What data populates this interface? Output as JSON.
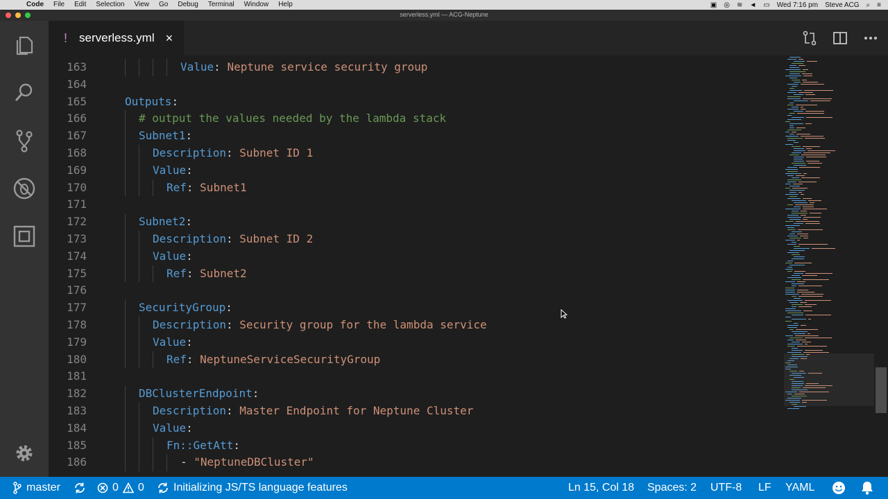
{
  "menubar": {
    "apple_icon": "apple-logo-icon",
    "items": [
      "Code",
      "File",
      "Edit",
      "Selection",
      "View",
      "Go",
      "Debug",
      "Terminal",
      "Window",
      "Help"
    ],
    "clock": "Wed 7:16 pm",
    "user": "Steve ACG"
  },
  "window": {
    "title": "serverless.yml — ACG-Neptune"
  },
  "activity_bar": [
    "files-icon",
    "search-icon",
    "source-control-icon",
    "debug-icon",
    "extensions-icon",
    "gear-icon"
  ],
  "tab": {
    "modified_marker": "!",
    "filename": "serverless.yml",
    "close_glyph": "×"
  },
  "tab_actions": [
    "compare-changes-icon",
    "split-editor-icon",
    "more-actions-icon"
  ],
  "editor": {
    "lines": [
      {
        "n": "163",
        "indent": 5,
        "parts": [
          {
            "t": "Value",
            "c": "k"
          },
          {
            "t": ": ",
            "c": "p"
          },
          {
            "t": "Neptune service security group",
            "c": "s"
          }
        ]
      },
      {
        "n": "164",
        "indent": 0,
        "parts": []
      },
      {
        "n": "165",
        "indent": 1,
        "parts": [
          {
            "t": "Outputs",
            "c": "k"
          },
          {
            "t": ":",
            "c": "p"
          }
        ]
      },
      {
        "n": "166",
        "indent": 2,
        "parts": [
          {
            "t": "# output the values needed by the lambda stack",
            "c": "c"
          }
        ]
      },
      {
        "n": "167",
        "indent": 2,
        "parts": [
          {
            "t": "Subnet1",
            "c": "k"
          },
          {
            "t": ":",
            "c": "p"
          }
        ]
      },
      {
        "n": "168",
        "indent": 3,
        "parts": [
          {
            "t": "Description",
            "c": "k"
          },
          {
            "t": ": ",
            "c": "p"
          },
          {
            "t": "Subnet ID 1",
            "c": "s"
          }
        ]
      },
      {
        "n": "169",
        "indent": 3,
        "parts": [
          {
            "t": "Value",
            "c": "k"
          },
          {
            "t": ":",
            "c": "p"
          }
        ]
      },
      {
        "n": "170",
        "indent": 4,
        "parts": [
          {
            "t": "Ref",
            "c": "k"
          },
          {
            "t": ": ",
            "c": "p"
          },
          {
            "t": "Subnet1",
            "c": "s"
          }
        ]
      },
      {
        "n": "171",
        "indent": 0,
        "parts": []
      },
      {
        "n": "172",
        "indent": 2,
        "parts": [
          {
            "t": "Subnet2",
            "c": "k"
          },
          {
            "t": ":",
            "c": "p"
          }
        ]
      },
      {
        "n": "173",
        "indent": 3,
        "parts": [
          {
            "t": "Description",
            "c": "k"
          },
          {
            "t": ": ",
            "c": "p"
          },
          {
            "t": "Subnet ID 2",
            "c": "s"
          }
        ]
      },
      {
        "n": "174",
        "indent": 3,
        "parts": [
          {
            "t": "Value",
            "c": "k"
          },
          {
            "t": ":",
            "c": "p"
          }
        ]
      },
      {
        "n": "175",
        "indent": 4,
        "parts": [
          {
            "t": "Ref",
            "c": "k"
          },
          {
            "t": ": ",
            "c": "p"
          },
          {
            "t": "Subnet2",
            "c": "s"
          }
        ]
      },
      {
        "n": "176",
        "indent": 0,
        "parts": []
      },
      {
        "n": "177",
        "indent": 2,
        "parts": [
          {
            "t": "SecurityGroup",
            "c": "k"
          },
          {
            "t": ":",
            "c": "p"
          }
        ]
      },
      {
        "n": "178",
        "indent": 3,
        "parts": [
          {
            "t": "Description",
            "c": "k"
          },
          {
            "t": ": ",
            "c": "p"
          },
          {
            "t": "Security group for the lambda service",
            "c": "s"
          }
        ]
      },
      {
        "n": "179",
        "indent": 3,
        "parts": [
          {
            "t": "Value",
            "c": "k"
          },
          {
            "t": ":",
            "c": "p"
          }
        ]
      },
      {
        "n": "180",
        "indent": 4,
        "parts": [
          {
            "t": "Ref",
            "c": "k"
          },
          {
            "t": ": ",
            "c": "p"
          },
          {
            "t": "NeptuneServiceSecurityGroup",
            "c": "s"
          }
        ]
      },
      {
        "n": "181",
        "indent": 0,
        "parts": []
      },
      {
        "n": "182",
        "indent": 2,
        "parts": [
          {
            "t": "DBClusterEndpoint",
            "c": "k"
          },
          {
            "t": ":",
            "c": "p"
          }
        ]
      },
      {
        "n": "183",
        "indent": 3,
        "parts": [
          {
            "t": "Description",
            "c": "k"
          },
          {
            "t": ": ",
            "c": "p"
          },
          {
            "t": "Master Endpoint for Neptune Cluster",
            "c": "s"
          }
        ]
      },
      {
        "n": "184",
        "indent": 3,
        "parts": [
          {
            "t": "Value",
            "c": "k"
          },
          {
            "t": ":",
            "c": "p"
          }
        ]
      },
      {
        "n": "185",
        "indent": 4,
        "parts": [
          {
            "t": "Fn::GetAtt",
            "c": "k"
          },
          {
            "t": ":",
            "c": "p"
          }
        ]
      },
      {
        "n": "186",
        "indent": 5,
        "parts": [
          {
            "t": "- ",
            "c": "p"
          },
          {
            "t": "\"NeptuneDBCluster\"",
            "c": "s"
          }
        ]
      }
    ]
  },
  "statusbar": {
    "branch": "master",
    "errors": "0",
    "warnings": "0",
    "progress": "Initializing JS/TS language features",
    "position": "Ln 15, Col 18",
    "spaces": "Spaces: 2",
    "encoding": "UTF-8",
    "eol": "LF",
    "language": "YAML"
  },
  "colors": {
    "statusbar": "#007acc",
    "keyword": "#569cd6",
    "string": "#ce9178",
    "comment": "#6a9955",
    "modified_marker": "#c586c0"
  }
}
